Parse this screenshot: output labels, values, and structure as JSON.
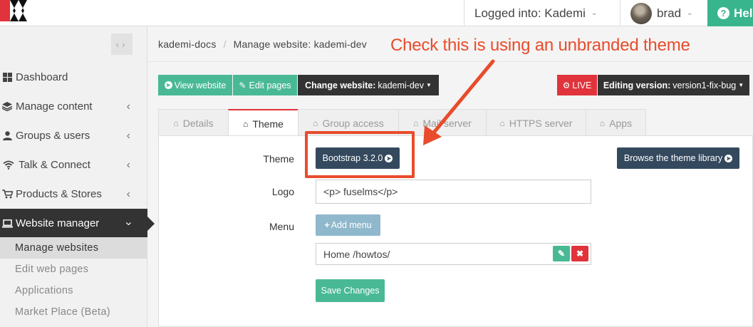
{
  "topbar": {
    "logged_into": "Logged into: Kademi",
    "user_name": "brad",
    "help_label": "Hel"
  },
  "sidebar": {
    "items": [
      {
        "icon": "th-large-icon",
        "label": "Dashboard"
      },
      {
        "icon": "stack-icon",
        "label": "Manage content"
      },
      {
        "icon": "user-icon",
        "label": "Groups & users"
      },
      {
        "icon": "wifi-icon",
        "label": "Talk & Connect"
      },
      {
        "icon": "cart-icon",
        "label": "Products & Stores"
      },
      {
        "icon": "laptop-icon",
        "label": "Website manager"
      }
    ],
    "subitems": [
      "Manage websites",
      "Edit web pages",
      "Applications",
      "Market Place (Beta)"
    ]
  },
  "breadcrumb": {
    "root": "kademi-docs",
    "current": "Manage website: kademi-dev"
  },
  "toolbar": {
    "view_website": "View website",
    "edit_pages": "Edit pages",
    "change_website_label": "Change website:",
    "change_website_value": "kademi-dev",
    "live_label": "LIVE",
    "editing_version_label": "Editing version:",
    "editing_version_value": "version1-fix-bug"
  },
  "tabs": [
    "Details",
    "Theme",
    "Group access",
    "Mail server",
    "HTTPS server",
    "Apps"
  ],
  "form": {
    "theme_label": "Theme",
    "theme_button": "Bootstrap 3.2.0",
    "browse_button": "Browse the theme library",
    "logo_label": "Logo",
    "logo_value": "<p> fuselms</p>",
    "menu_label": "Menu",
    "add_menu": "Add menu",
    "menu_item": "Home /howtos/",
    "save_button": "Save Changes"
  },
  "annotation": {
    "text": "Check this is using an unbranded theme"
  },
  "colors": {
    "accent_red": "#e84c2c",
    "teal": "#49b995",
    "navy": "#34495e",
    "sidebar_active": "#333333"
  }
}
